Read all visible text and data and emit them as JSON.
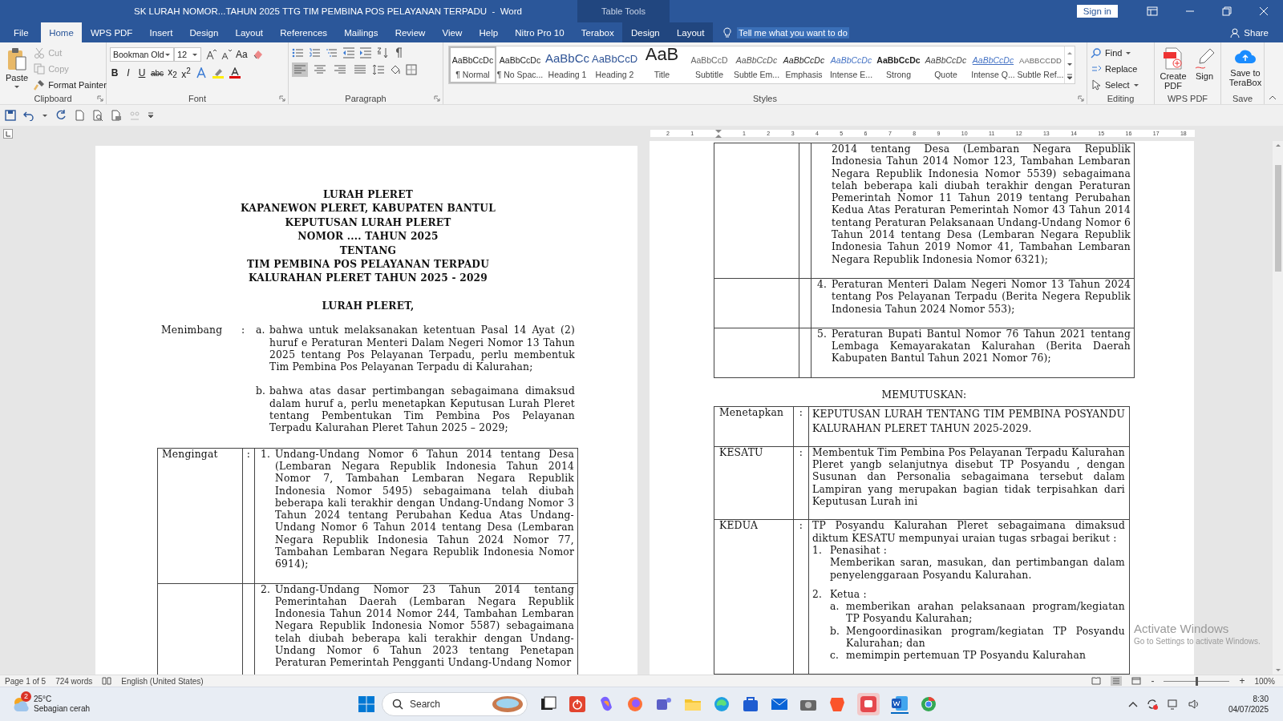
{
  "title_bar": {
    "title": "SK LURAH NOMOR...TAHUN 2025 TTG TIM PEMBINA POS PELAYANAN TERPADU  -  Word",
    "context_label": "Table Tools",
    "sign_in": "Sign in"
  },
  "ribbon_tabs": [
    {
      "label": "File",
      "selected": false,
      "kind": "normal"
    },
    {
      "label": "Home",
      "selected": true,
      "kind": "normal"
    },
    {
      "label": "WPS PDF",
      "selected": false,
      "kind": "normal"
    },
    {
      "label": "Insert",
      "selected": false,
      "kind": "normal"
    },
    {
      "label": "Design",
      "selected": false,
      "kind": "normal"
    },
    {
      "label": "Layout",
      "selected": false,
      "kind": "normal"
    },
    {
      "label": "References",
      "selected": false,
      "kind": "normal"
    },
    {
      "label": "Mailings",
      "selected": false,
      "kind": "normal"
    },
    {
      "label": "Review",
      "selected": false,
      "kind": "normal"
    },
    {
      "label": "View",
      "selected": false,
      "kind": "normal"
    },
    {
      "label": "Help",
      "selected": false,
      "kind": "normal"
    },
    {
      "label": "Nitro Pro 10",
      "selected": false,
      "kind": "normal"
    },
    {
      "label": "Terabox",
      "selected": false,
      "kind": "normal"
    },
    {
      "label": "Design",
      "selected": false,
      "kind": "contextual"
    },
    {
      "label": "Layout",
      "selected": false,
      "kind": "contextual"
    }
  ],
  "tell_me": "Tell me what you want to do",
  "share": "Share",
  "clipboard": {
    "group_label": "Clipboard",
    "paste": "Paste",
    "cut": {
      "label": "Cut",
      "disabled": true
    },
    "copy": {
      "label": "Copy",
      "disabled": true
    },
    "format_painter": "Format Painter"
  },
  "font": {
    "group_label": "Font",
    "name": "Bookman Old",
    "size": "12",
    "case_button": "Aa",
    "format_buttons": [
      "B",
      "I",
      "U",
      "abc",
      "x$_{2}$",
      "x$^{2}$"
    ]
  },
  "paragraph": {
    "group_label": "Paragraph",
    "alignment_buttons": [
      {
        "selected": true
      },
      {
        "selected": false
      },
      {
        "selected": false
      },
      {
        "selected": false
      }
    ]
  },
  "styles": {
    "group_label": "Styles",
    "items": [
      {
        "sample": "AaBbCcDc",
        "label": "¶ Normal",
        "kind": "normal",
        "selected": true
      },
      {
        "sample": "AaBbCcDc",
        "label": "¶ No Spac...",
        "kind": "normal",
        "selected": false
      },
      {
        "sample": "AaBbCc",
        "label": "Heading 1",
        "kind": "heading1",
        "selected": false
      },
      {
        "sample": "AaBbCcD",
        "label": "Heading 2",
        "kind": "heading2",
        "selected": false
      },
      {
        "sample": "AaB",
        "label": "Title",
        "kind": "title",
        "selected": false
      },
      {
        "sample": "AaBbCcD",
        "label": "Subtitle",
        "kind": "subtitle",
        "selected": false
      },
      {
        "sample": "AaBbCcDc",
        "label": "Subtle Em...",
        "kind": "subtle",
        "selected": false
      },
      {
        "sample": "AaBbCcDc",
        "label": "Emphasis",
        "kind": "emphasis",
        "selected": false
      },
      {
        "sample": "AaBbCcDc",
        "label": "Intense E...",
        "kind": "intense",
        "selected": false
      },
      {
        "sample": "AaBbCcDc",
        "label": "Strong",
        "kind": "strong",
        "selected": false
      },
      {
        "sample": "AaBbCcDc",
        "label": "Quote",
        "kind": "quote",
        "selected": false
      },
      {
        "sample": "AaBbCcDc",
        "label": "Intense Q...",
        "kind": "intense_quote",
        "selected": false
      },
      {
        "sample": "AABBCCDD",
        "label": "Subtle Ref...",
        "kind": "reference",
        "selected": false
      }
    ]
  },
  "editing": {
    "group_label": "Editing",
    "find": "Find",
    "replace": "Replace",
    "select": "Select"
  },
  "wps_pdf": {
    "group_label": "WPS PDF",
    "create": "Create PDF",
    "sign": "Sign"
  },
  "save": {
    "group_label": "Save",
    "save_to": "Save to TeraBox"
  },
  "ruler": {
    "labels": [
      "2",
      "1",
      "1",
      "2",
      "3",
      "4",
      "5",
      "6",
      "7",
      "8",
      "9",
      "10",
      "11",
      "12",
      "13",
      "14",
      "15",
      "16",
      "17",
      "18"
    ]
  },
  "left_page": {
    "heading": [
      "LURAH PLERET",
      "KAPANEWON PLERET, KABUPATEN BANTUL",
      "KEPUTUSAN LURAH PLERET",
      "NOMOR .... TAHUN 2025",
      "TENTANG",
      "TIM PEMBINA POS PELAYANAN TERPADU",
      "KALURAHAN PLERET TAHUN 2025 - 2029"
    ],
    "subheading": "LURAH PLERET,",
    "considering": {
      "label": "Menimbang",
      "colon": ":",
      "items": [
        {
          "marker": "a.",
          "text": "bahwa untuk melaksanakan ketentuan Pasal 14 Ayat (2) huruf e Peraturan Menteri Dalam Negeri Nomor 13 Tahun 2025 tentang Pos Pelayanan Terpadu, perlu membentuk Tim Pembina Pos Pelayanan Terpadu di Kalurahan;"
        },
        {
          "marker": "b.",
          "text": "bahwa atas dasar pertimbangan sebagaimana dimaksud dalam huruf a, perlu menetapkan Keputusan Lurah Pleret tentang Pembentukan Tim Pembina Pos Pelayanan Terpadu Kalurahan Pleret Tahun 2025 – 2029;"
        }
      ]
    },
    "recital_table": {
      "rows": [
        {
          "label": "Mengingat",
          "colon": ":",
          "marker": "1.",
          "text": "Undang-Undang Nomor 6 Tahun 2014 tentang Desa (Lembaran Negara Republik Indonesia Tahun 2014 Nomor 7, Tambahan Lembaran Negara Republik Indonesia Nomor 5495) sebagaimana telah diubah beberapa kali terakhir dengan Undang-Undang Nomor 3 Tahun 2024 tentang Perubahan Kedua Atas Undang-Undang Nomor 6 Tahun 2014 tentang Desa (Lembaran Negara Republik Indonesia Tahun 2024 Nomor 77, Tambahan Lembaran Negara Republik Indonesia Nomor 6914);"
        },
        {
          "marker": "2.",
          "text": "Undang-Undang Nomor 23 Tahun 2014 tentang Pemerintahan Daerah (Lembaran Negara Republik Indonesia Tahun 2014 Nomor 244, Tambahan Lembaran Negara Republik Indonesia Nomor 5587) sebagaimana telah diubah beberapa kali terakhir dengan Undang-Undang Nomor 6 Tahun 2023 tentang Penetapan Peraturan Pemerintah Pengganti Undang-Undang Nomor"
        }
      ]
    }
  },
  "right_page": {
    "recital_table": {
      "rows": [
        {
          "text": "2014 tentang Desa (Lembaran Negara Republik Indonesia Tahun 2014 Nomor 123, Tambahan Lembaran Negara Republik Indonesia Nomor 5539) sebagaimana telah beberapa kali diubah terakhir dengan Peraturan Pemerintah Nomor 11 Tahun 2019 tentang Perubahan Kedua Atas Peraturan Pemerintah Nomor 43 Tahun 2014 tentang Peraturan Pelaksanaan Undang-Undang Nomor 6 Tahun 2014 tentang Desa (Lembaran Negara Republik Indonesia Tahun 2019 Nomor 41, Tambahan Lembaran Negara Republik Indonesia Nomor 6321);"
        },
        {
          "marker": "4.",
          "text": "Peraturan Menteri Dalam Negeri Nomor 13 Tahun 2024 tentang Pos Pelayanan Terpadu (Berita Negera Republik Indonesia Tahun 2024 Nomor 553);"
        },
        {
          "marker": "5.",
          "text": "Peraturan Bupati Bantul Nomor 76 Tahun 2021 tentang Lembaga Kemayarakatan Kalurahan (Berita Daerah Kabupaten Bantul Tahun 2021 Nomor 76);"
        }
      ]
    },
    "decision_heading": "MEMUTUSKAN:",
    "decision_table": {
      "rows": [
        {
          "label": "Menetapkan",
          "colon": ":",
          "text": "KEPUTUSAN LURAH TENTANG TIM PEMBINA POSYANDU KALURAHAN PLERET TAHUN 2025-2029."
        },
        {
          "label": "KESATU",
          "colon": ":",
          "text": "Membentuk Tim Pembina Pos Pelayanan Terpadu Kalurahan Pleret yangb selanjutnya disebut TP Posyandu , dengan Susunan dan Personalia sebagaimana tersebut dalam Lampiran yang merupakan bagian tidak terpisahkan dari Keputusan Lurah ini"
        },
        {
          "label": "KEDUA",
          "colon": ":",
          "text": "TP Posyandu Kalurahan Pleret sebagaimana dimaksud diktum KESATU mempunyai uraian tugas srbagai berikut :",
          "items": [
            {
              "marker": "1.",
              "title": "Penasihat :",
              "text": "Memberikan saran, masukan, dan pertimbangan dalam penyelenggaraan Posyandu Kalurahan."
            },
            {
              "marker": "2.",
              "title": "Ketua :",
              "subitems": [
                {
                  "marker": "a.",
                  "text": "memberikan arahan pelaksanaan program/kegiatan TP Posyandu Kalurahan;"
                },
                {
                  "marker": "b.",
                  "text": "Mengoordinasikan program/kegiatan TP Posyandu Kalurahan; dan"
                },
                {
                  "marker": "c.",
                  "text": "memimpin pertemuan TP Posyandu Kalurahan"
                }
              ]
            }
          ]
        }
      ]
    }
  },
  "activation": {
    "title": "Activate Windows",
    "hint": "Go to Settings to activate Windows."
  },
  "status_bar": {
    "page": "Page 1 of 5",
    "words": "724 words",
    "language": "English (United States)",
    "zoom_out": "-",
    "zoom_in": "+",
    "zoom": {
      "label": "100%",
      "level": 0.5
    }
  },
  "taskbar": {
    "weather": {
      "badge": "2",
      "temperature": "25°C",
      "condition": "Sebagian cerah"
    },
    "search": {
      "placeholder": "Search"
    },
    "time": "8:30",
    "date": "04/07/2025"
  }
}
